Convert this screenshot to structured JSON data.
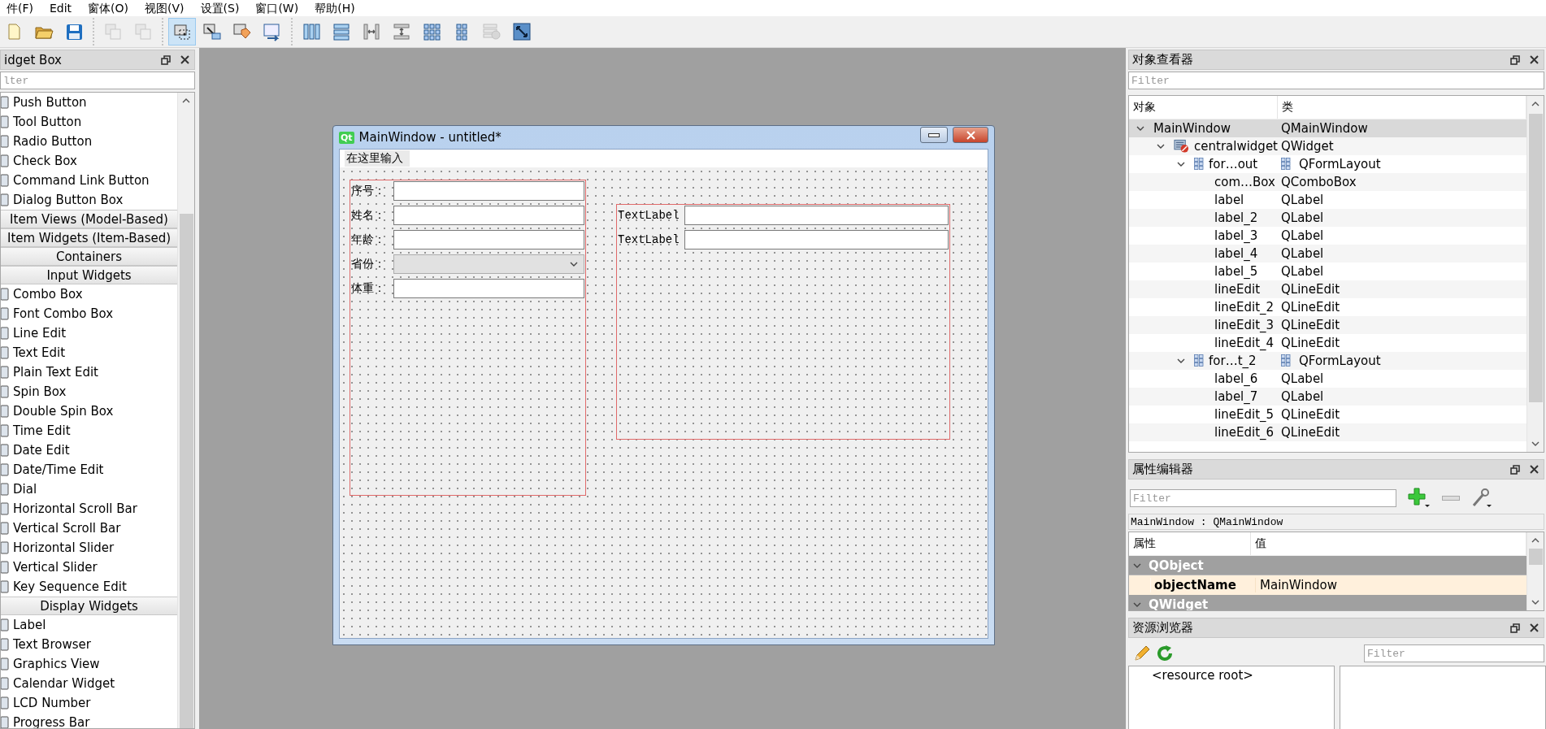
{
  "menu": [
    "件(F)",
    "Edit",
    "窗体(O)",
    "视图(V)",
    "设置(S)",
    "窗口(W)",
    "帮助(H)"
  ],
  "toolbar": [
    [
      {
        "kind": "new",
        "selected": false,
        "disabled": false
      },
      {
        "kind": "open",
        "selected": false,
        "disabled": false
      },
      {
        "kind": "save",
        "selected": false,
        "disabled": false
      }
    ],
    [
      {
        "kind": "lower",
        "selected": false,
        "disabled": true
      },
      {
        "kind": "raise",
        "selected": false,
        "disabled": true
      }
    ],
    [
      {
        "kind": "edit_widgets",
        "selected": true,
        "disabled": false
      },
      {
        "kind": "edit_signals",
        "selected": false,
        "disabled": false
      },
      {
        "kind": "edit_buddies",
        "selected": false,
        "disabled": false
      },
      {
        "kind": "edit_tab_order",
        "selected": false,
        "disabled": false
      }
    ],
    [
      {
        "kind": "layout_h",
        "selected": false,
        "disabled": false
      },
      {
        "kind": "layout_v",
        "selected": false,
        "disabled": false
      },
      {
        "kind": "splitter_h",
        "selected": false,
        "disabled": false
      },
      {
        "kind": "splitter_v",
        "selected": false,
        "disabled": false
      },
      {
        "kind": "layout_grid",
        "selected": false,
        "disabled": false
      },
      {
        "kind": "layout_form",
        "selected": false,
        "disabled": false
      },
      {
        "kind": "break_layout",
        "selected": false,
        "disabled": true
      },
      {
        "kind": "adjust_size",
        "selected": false,
        "disabled": false
      }
    ]
  ],
  "widget_box": {
    "title": "idget Box",
    "filter": {
      "placeholder": "lter"
    },
    "items": [
      {
        "kind": "item",
        "label": "Push Button"
      },
      {
        "kind": "item",
        "label": "Tool Button"
      },
      {
        "kind": "item",
        "label": "Radio Button"
      },
      {
        "kind": "item",
        "label": "Check Box"
      },
      {
        "kind": "item",
        "label": "Command Link Button"
      },
      {
        "kind": "item",
        "label": "Dialog Button Box"
      },
      {
        "kind": "category",
        "label": "Item Views (Model-Based)"
      },
      {
        "kind": "category",
        "label": "Item Widgets (Item-Based)"
      },
      {
        "kind": "category",
        "label": "Containers"
      },
      {
        "kind": "category",
        "label": "Input Widgets"
      },
      {
        "kind": "item",
        "label": "Combo Box"
      },
      {
        "kind": "item",
        "label": "Font Combo Box"
      },
      {
        "kind": "item",
        "label": "Line Edit"
      },
      {
        "kind": "item",
        "label": "Text Edit"
      },
      {
        "kind": "item",
        "label": "Plain Text Edit"
      },
      {
        "kind": "item",
        "label": "Spin Box"
      },
      {
        "kind": "item",
        "label": "Double Spin Box"
      },
      {
        "kind": "item",
        "label": "Time Edit"
      },
      {
        "kind": "item",
        "label": "Date Edit"
      },
      {
        "kind": "item",
        "label": "Date/Time Edit"
      },
      {
        "kind": "item",
        "label": "Dial"
      },
      {
        "kind": "item",
        "label": "Horizontal Scroll Bar"
      },
      {
        "kind": "item",
        "label": "Vertical Scroll Bar"
      },
      {
        "kind": "item",
        "label": "Horizontal Slider"
      },
      {
        "kind": "item",
        "label": "Vertical Slider"
      },
      {
        "kind": "item",
        "label": "Key Sequence Edit"
      },
      {
        "kind": "category",
        "label": "Display Widgets"
      },
      {
        "kind": "item",
        "label": "Label"
      },
      {
        "kind": "item",
        "label": "Text Browser"
      },
      {
        "kind": "item",
        "label": "Graphics View"
      },
      {
        "kind": "item",
        "label": "Calendar Widget"
      },
      {
        "kind": "item",
        "label": "LCD Number"
      },
      {
        "kind": "item",
        "label": "Progress Bar"
      }
    ]
  },
  "form_window": {
    "logo": "Qt",
    "title": "MainWindow - untitled*",
    "menu": [
      "在这里输入"
    ],
    "layouts": [
      {
        "rows": [
          {
            "label": "序号：",
            "kind": "line"
          },
          {
            "label": "姓名：",
            "kind": "line"
          },
          {
            "label": "年龄：",
            "kind": "line"
          },
          {
            "label": "省份：",
            "kind": "combo"
          },
          {
            "label": "体重：",
            "kind": "line"
          }
        ]
      },
      {
        "rows": [
          {
            "label": "TextLabel",
            "kind": "line"
          },
          {
            "label": "TextLabel",
            "kind": "line"
          }
        ]
      }
    ]
  },
  "object_inspector": {
    "title": "对象查看器",
    "filter": {
      "placeholder": "Filter"
    },
    "columns": [
      "对象",
      "类"
    ],
    "tree": [
      {
        "name": "MainWindow",
        "class": "QMainWindow",
        "expanded": true,
        "selected": true,
        "children": [
          {
            "name": "centralwidget",
            "class": "QWidget",
            "kind": "widget",
            "expanded": true,
            "selected": false,
            "children": [
              {
                "name": "for…out",
                "class": "QFormLayout",
                "kind": "layout",
                "expanded": true,
                "selected": false,
                "children": [
                  {
                    "name": "com…Box",
                    "class": "QComboBox",
                    "selected": false
                  },
                  {
                    "name": "label",
                    "class": "QLabel",
                    "selected": false
                  },
                  {
                    "name": "label_2",
                    "class": "QLabel",
                    "selected": false
                  },
                  {
                    "name": "label_3",
                    "class": "QLabel",
                    "selected": false
                  },
                  {
                    "name": "label_4",
                    "class": "QLabel",
                    "selected": false
                  },
                  {
                    "name": "label_5",
                    "class": "QLabel",
                    "selected": false
                  },
                  {
                    "name": "lineEdit",
                    "class": "QLineEdit",
                    "selected": false
                  },
                  {
                    "name": "lineEdit_2",
                    "class": "QLineEdit",
                    "selected": false
                  },
                  {
                    "name": "lineEdit_3",
                    "class": "QLineEdit",
                    "selected": false
                  },
                  {
                    "name": "lineEdit_4",
                    "class": "QLineEdit",
                    "selected": false
                  }
                ]
              },
              {
                "name": "for…t_2",
                "class": "QFormLayout",
                "kind": "layout",
                "expanded": true,
                "selected": false,
                "children": [
                  {
                    "name": "label_6",
                    "class": "QLabel",
                    "selected": false
                  },
                  {
                    "name": "label_7",
                    "class": "QLabel",
                    "selected": false
                  },
                  {
                    "name": "lineEdit_5",
                    "class": "QLineEdit",
                    "selected": false
                  },
                  {
                    "name": "lineEdit_6",
                    "class": "QLineEdit",
                    "selected": false
                  }
                ]
              }
            ]
          }
        ]
      }
    ]
  },
  "property_editor": {
    "title": "属性编辑器",
    "filter": {
      "placeholder": "Filter"
    },
    "object": "MainWindow : QMainWindow",
    "columns": [
      "属性",
      "值"
    ],
    "groups": [
      {
        "name": "QObject",
        "expanded": true,
        "properties": [
          {
            "name": "objectName",
            "value": "MainWindow",
            "changed": true
          }
        ]
      },
      {
        "name": "QWidget",
        "expanded": true
      }
    ]
  },
  "resource_browser": {
    "title": "资源浏览器",
    "filter": {
      "placeholder": "Filter"
    },
    "tree": [
      "<resource root>"
    ]
  }
}
